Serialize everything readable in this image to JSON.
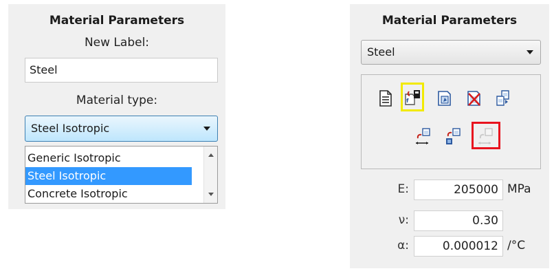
{
  "left": {
    "title": "Material Parameters",
    "new_label_caption": "New Label:",
    "new_label_value": "Steel",
    "material_type_caption": "Material type:",
    "material_type_selected": "Steel Isotropic",
    "material_type_options": [
      "Generic Isotropic",
      "Steel Isotropic",
      "Concrete Isotropic"
    ]
  },
  "right": {
    "title": "Material Parameters",
    "material_selected": "Steel",
    "toolbar_icons": [
      "material-properties-icon",
      "edit-parameters-icon",
      "new-material-icon",
      "delete-material-icon",
      "copy-material-icon",
      "apply-to-selection-icon",
      "apply-to-all-icon",
      "apply-to-members-icon"
    ],
    "properties": [
      {
        "symbol": "E:",
        "value": "205000",
        "unit": "MPa"
      },
      {
        "symbol": "ν:",
        "value": "0.30",
        "unit": ""
      },
      {
        "symbol": "α:",
        "value": "0.000012",
        "unit": "/°C"
      }
    ]
  },
  "colors": {
    "panel_bg": "#f0f0f0",
    "selection": "#3399ff",
    "combo_focus_border": "#3c7fb1",
    "highlight_yellow": "#f2ea00",
    "highlight_red": "#e8131e"
  }
}
